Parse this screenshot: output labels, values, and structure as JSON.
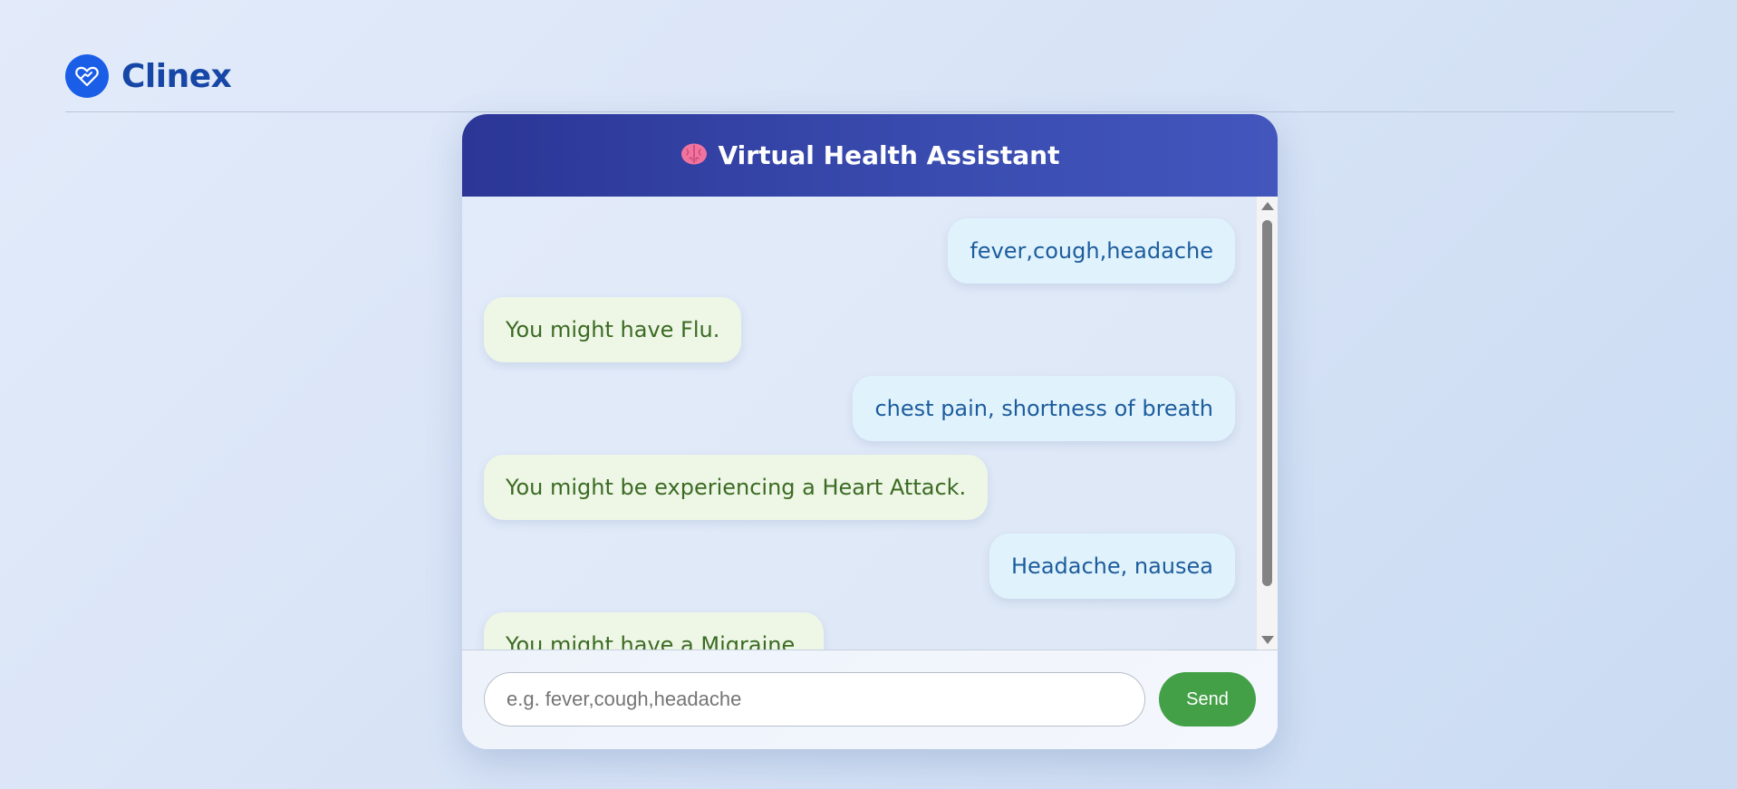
{
  "brand": {
    "name": "Clinex",
    "logo_icon": "heart-handshake-icon"
  },
  "chat": {
    "title": "Virtual Health Assistant",
    "title_icon": "brain-icon",
    "messages": [
      {
        "sender": "user",
        "text": "fever,cough,headache"
      },
      {
        "sender": "bot",
        "text": "You might have Flu."
      },
      {
        "sender": "user",
        "text": "chest pain, shortness of breath"
      },
      {
        "sender": "bot",
        "text": "You might be experiencing a Heart Attack."
      },
      {
        "sender": "user",
        "text": "Headache, nausea"
      },
      {
        "sender": "bot",
        "text": "You might have a Migraine."
      }
    ],
    "input": {
      "value": "",
      "placeholder": "e.g. fever,cough,headache"
    },
    "send_label": "Send"
  },
  "colors": {
    "brand": "#1a5ee8",
    "header_start": "#2b3696",
    "header_end": "#4256bd",
    "user_bubble": "#e0f3fd",
    "bot_bubble": "#eef6e6",
    "send_button": "#43a047"
  }
}
